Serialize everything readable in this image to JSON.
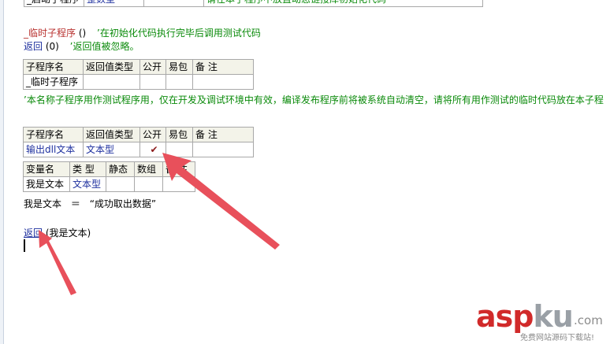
{
  "top_row": {
    "name": "_启动子程序",
    "type": "整数型",
    "note": "请在本子程序中放置动态链接库初始化代码"
  },
  "temp_section": {
    "header_line_name": "_临时子程序",
    "header_line_params": "()",
    "header_line_comment": "’在初始化代码执行完毕后调用测试代码",
    "return_line_keyword": "返回",
    "return_line_args": "(0)",
    "return_line_comment": "’返回值被忽略。"
  },
  "table1": {
    "headers": [
      "子程序名",
      "返回值类型",
      "公开",
      "易包",
      "备 注"
    ],
    "row": [
      "_临时子程序",
      "",
      "",
      "",
      ""
    ]
  },
  "note_line": "’本名称子程序用作测试程序用，仅在开发及调试环境中有效，编译发布程序前将被系统自动清空，请将所有用作测试的临时代码放在本子程",
  "table2": {
    "headers": [
      "子程序名",
      "返回值类型",
      "公开",
      "易包",
      "备 注"
    ],
    "row": [
      "输出dll文本",
      "文本型",
      "✔",
      "",
      ""
    ]
  },
  "table3": {
    "headers": [
      "变量名",
      "类 型",
      "静态",
      "数组",
      "备 注"
    ],
    "row": [
      "我是文本",
      "文本型",
      "",
      "",
      ""
    ]
  },
  "assign_line": {
    "var": "我是文本",
    "op": "＝",
    "value": "“成功取出数据”"
  },
  "return_line": {
    "keyword": "返回",
    "args": "(我是文本)"
  },
  "watermark": {
    "asp": "asp",
    "ku": "ku",
    "com": ".com",
    "sub": "免费网站源码下载站!"
  },
  "colors": {
    "arrow": "#e8505b",
    "keyword_red": "#b8312f",
    "comment_green": "#0a8a0a",
    "type_blue": "#1d2f9e"
  }
}
